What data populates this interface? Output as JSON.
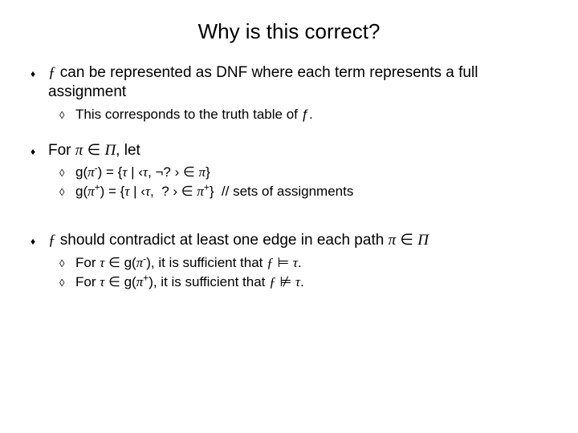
{
  "title": "Why is this correct?",
  "bullets": {
    "a": {
      "main_pre": "ƒ",
      "main_post": " can be represented as DNF where each term represents a full assignment",
      "sub1": "This corresponds to the truth table of ƒ."
    },
    "b": {
      "main": "For π ∈ Π, let",
      "sub1": "g(π⁻) = {τ | ‹τ, ¬? › ∈ π}",
      "sub2": "g(π⁺) = {τ | ‹τ,  ? › ∈ π⁺}  // sets of assignments"
    },
    "c": {
      "main": "ƒ should contradict at least one edge in each path π ∈ Π",
      "sub1": "For τ ∈ g(π⁻), it is sufficient that ƒ ⊨ τ.",
      "sub2": "For τ ∈ g(π⁺), it is sufficient that ƒ ⊭ τ."
    }
  }
}
